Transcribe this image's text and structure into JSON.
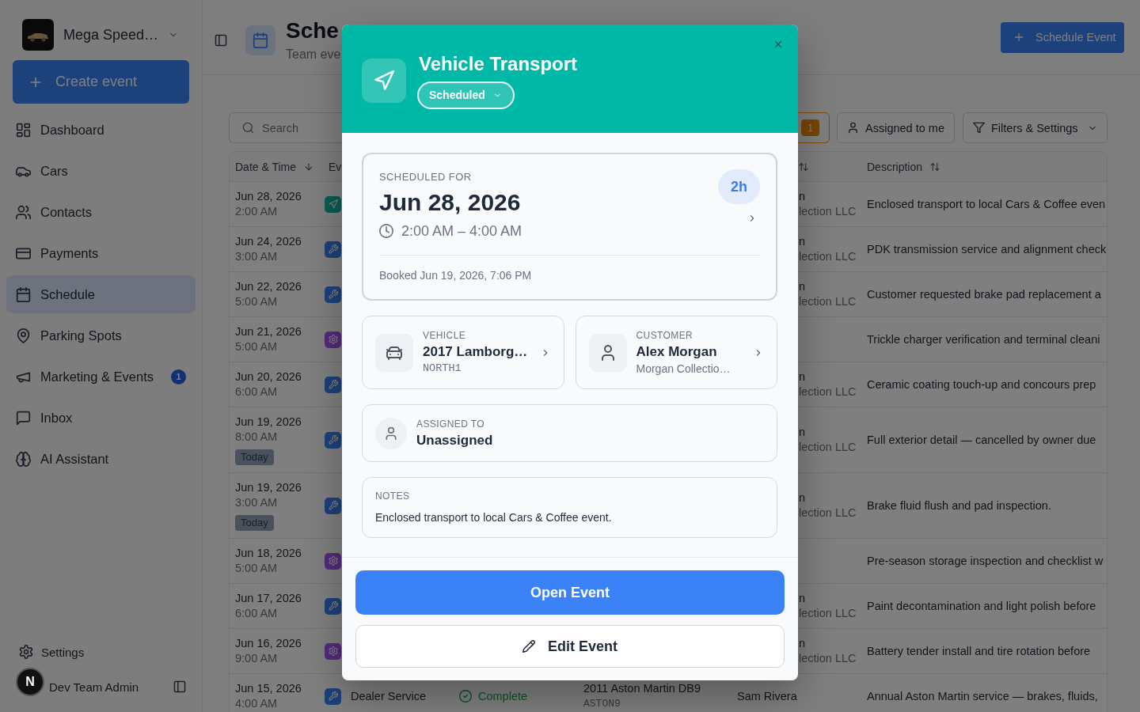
{
  "sidebar": {
    "workspace": {
      "name": "Mega Speed…"
    },
    "create_button": {
      "label": "Create event"
    },
    "nav_items": [
      {
        "label": "Dashboard",
        "selected": false
      },
      {
        "label": "Cars",
        "selected": false
      },
      {
        "label": "Contacts",
        "selected": false
      },
      {
        "label": "Payments",
        "selected": false
      },
      {
        "label": "Schedule",
        "selected": true
      },
      {
        "label": "Parking Spots",
        "selected": false
      },
      {
        "label": "Marketing & Events",
        "selected": false,
        "badge": "1"
      },
      {
        "label": "Inbox",
        "selected": false
      },
      {
        "label": "AI Assistant",
        "selected": false
      }
    ],
    "settings": {
      "label": "Settings"
    },
    "user": {
      "name": "Dev Team Admin"
    }
  },
  "header": {
    "title": "Sche",
    "subtitle": "Team eve",
    "schedule_button": {
      "label": "Schedule Event"
    }
  },
  "toolbar": {
    "search": {
      "placeholder": "Search"
    },
    "count_badge": "1",
    "assigned_button": {
      "label": "Assigned to me"
    },
    "filters_button": {
      "label": "Filters & Settings"
    }
  },
  "table": {
    "columns": [
      {
        "label": "Date & Time",
        "sorted": true
      },
      {
        "label": "Ev"
      },
      {},
      {},
      {
        "sorted": false
      },
      {
        "label": "Description",
        "sorted": false
      }
    ],
    "rows": [
      {
        "date": "Jun 28, 2026",
        "time": "2:00 AM",
        "event": {
          "kind": "transport"
        },
        "customer": {
          "name_end": "n",
          "company_end": "lection LLC"
        },
        "description": "Enclosed transport to local Cars & Coffee even"
      },
      {
        "date": "Jun 24, 2026",
        "time": "3:00 AM",
        "event": {
          "kind": "service"
        },
        "customer": {
          "name_end": "n",
          "company_end": "lection LLC"
        },
        "description": "PDK transmission service and alignment check"
      },
      {
        "date": "Jun 22, 2026",
        "time": "5:00 AM",
        "event": {
          "kind": "service"
        },
        "customer": {
          "name_end": "n",
          "company_end": "lection LLC"
        },
        "description": "Customer requested brake pad replacement a"
      },
      {
        "date": "Jun 21, 2026",
        "time": "5:00 AM",
        "event": {
          "kind": "maintenance"
        },
        "description": "Trickle charger verification and terminal cleani"
      },
      {
        "date": "Jun 20, 2026",
        "time": "6:00 AM",
        "event": {
          "kind": "service"
        },
        "customer": {
          "name_end": "n",
          "company_end": "lection LLC"
        },
        "description": "Ceramic coating touch-up and concours prep"
      },
      {
        "date": "Jun 19, 2026",
        "time": "8:00 AM",
        "tag": "Today",
        "event": {
          "kind": "service"
        },
        "customer": {
          "name_end": "n",
          "company_end": "lection LLC"
        },
        "description": "Full exterior detail — cancelled by owner due"
      },
      {
        "date": "Jun 19, 2026",
        "time": "3:00 AM",
        "tag": "Today",
        "event": {
          "kind": "service"
        },
        "customer": {
          "name_end": "n",
          "company_end": "lection LLC"
        },
        "description": "Brake fluid flush and pad inspection."
      },
      {
        "date": "Jun 18, 2026",
        "time": "5:00 AM",
        "event": {
          "kind": "maintenance"
        },
        "description": "Pre-season storage inspection and checklist w"
      },
      {
        "date": "Jun 17, 2026",
        "time": "6:00 AM",
        "event": {
          "kind": "service"
        },
        "customer": {
          "name_end": "n",
          "company_end": "lection LLC"
        },
        "description": "Paint decontamination and light polish before"
      },
      {
        "date": "Jun 16, 2026",
        "time": "9:00 AM",
        "event": {
          "kind": "maintenance"
        },
        "customer": {
          "name_end": "n",
          "company_end": "lection LLC"
        },
        "description": "Battery tender install and tire rotation before"
      },
      {
        "date": "Jun 15, 2026",
        "time": "4:00 AM",
        "event": {
          "kind": "service",
          "label": "Dealer Service"
        },
        "status": {
          "kind": "complete",
          "label": "Complete"
        },
        "vehicle": {
          "name": "2011 Aston Martin DB9",
          "plate": "ASTON9"
        },
        "customer": {
          "name": "Sam Rivera"
        },
        "description": "Annual Aston Martin service — brakes, fluids,"
      }
    ]
  },
  "event_dialog": {
    "title": "Vehicle Transport",
    "status": {
      "label": "Scheduled"
    },
    "schedule": {
      "label": "SCHEDULED FOR",
      "date": "Jun 28, 2026",
      "time_range": "2:00 AM – 4:00 AM",
      "duration": "2h",
      "booked": "Booked Jun 19, 2026, 7:06 PM"
    },
    "vehicle": {
      "label": "VEHICLE",
      "name": "2017 Lamborg…",
      "plate": "NORTH1"
    },
    "customer": {
      "label": "CUSTOMER",
      "name": "Alex Morgan",
      "company": "Morgan Collectio…"
    },
    "assigned": {
      "label": "ASSIGNED TO",
      "name": "Unassigned"
    },
    "notes": {
      "label": "NOTES",
      "text": "Enclosed transport to local Cars & Coffee event."
    },
    "open_button": {
      "label": "Open Event"
    },
    "edit_button": {
      "label": "Edit Event"
    }
  },
  "dev_indicator": {
    "label": "N"
  }
}
